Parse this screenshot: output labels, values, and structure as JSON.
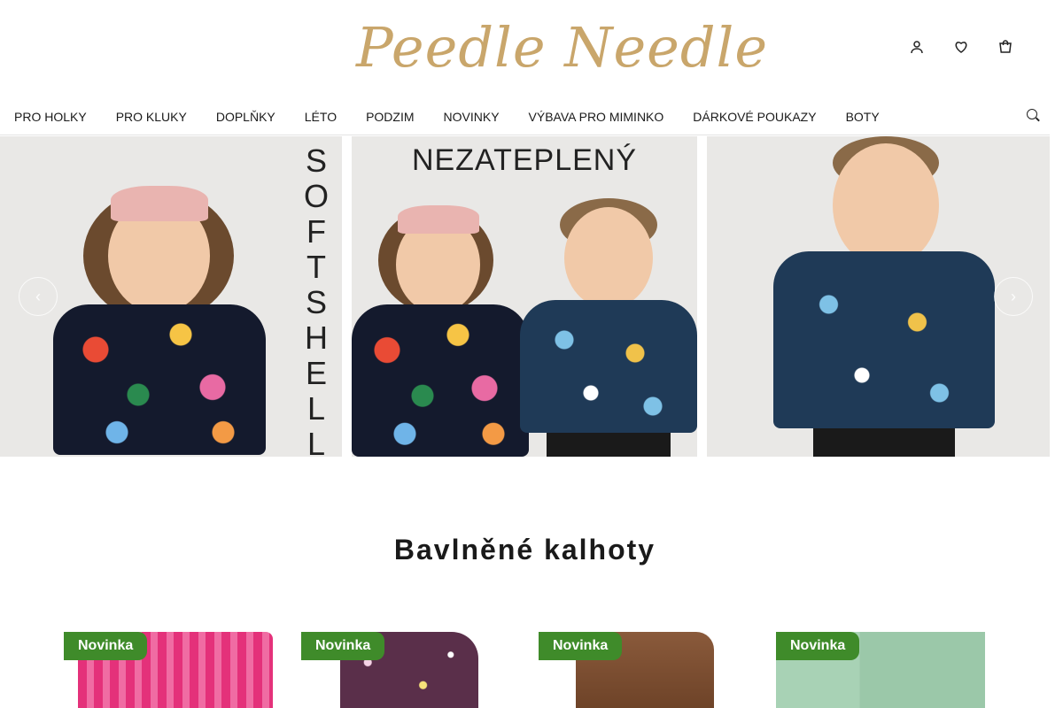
{
  "header": {
    "logo_text": "Peedle Needle",
    "icons": [
      "user-icon",
      "heart-icon",
      "cart-icon"
    ]
  },
  "nav": {
    "items": [
      "PRO HOLKY",
      "PRO KLUKY",
      "DOPLŇKY",
      "LÉTO",
      "PODZIM",
      "NOVINKY",
      "VÝBAVA PRO MIMINKO",
      "DÁRKOVÉ POUKAZY",
      "BOTY"
    ]
  },
  "hero": {
    "panel1_text": [
      "S",
      "O",
      "F",
      "T",
      "S",
      "H",
      "E",
      "L",
      "L"
    ],
    "panel2_text": "NEZATEPLENÝ",
    "prev_label": "‹",
    "next_label": "›"
  },
  "section": {
    "title": "Bavlněné kalhoty"
  },
  "products": [
    {
      "badge": "Novinka"
    },
    {
      "badge": "Novinka"
    },
    {
      "badge": "Novinka"
    },
    {
      "badge": "Novinka"
    }
  ],
  "colors": {
    "logo": "#c9a66b",
    "badge": "#3f8b2a"
  }
}
